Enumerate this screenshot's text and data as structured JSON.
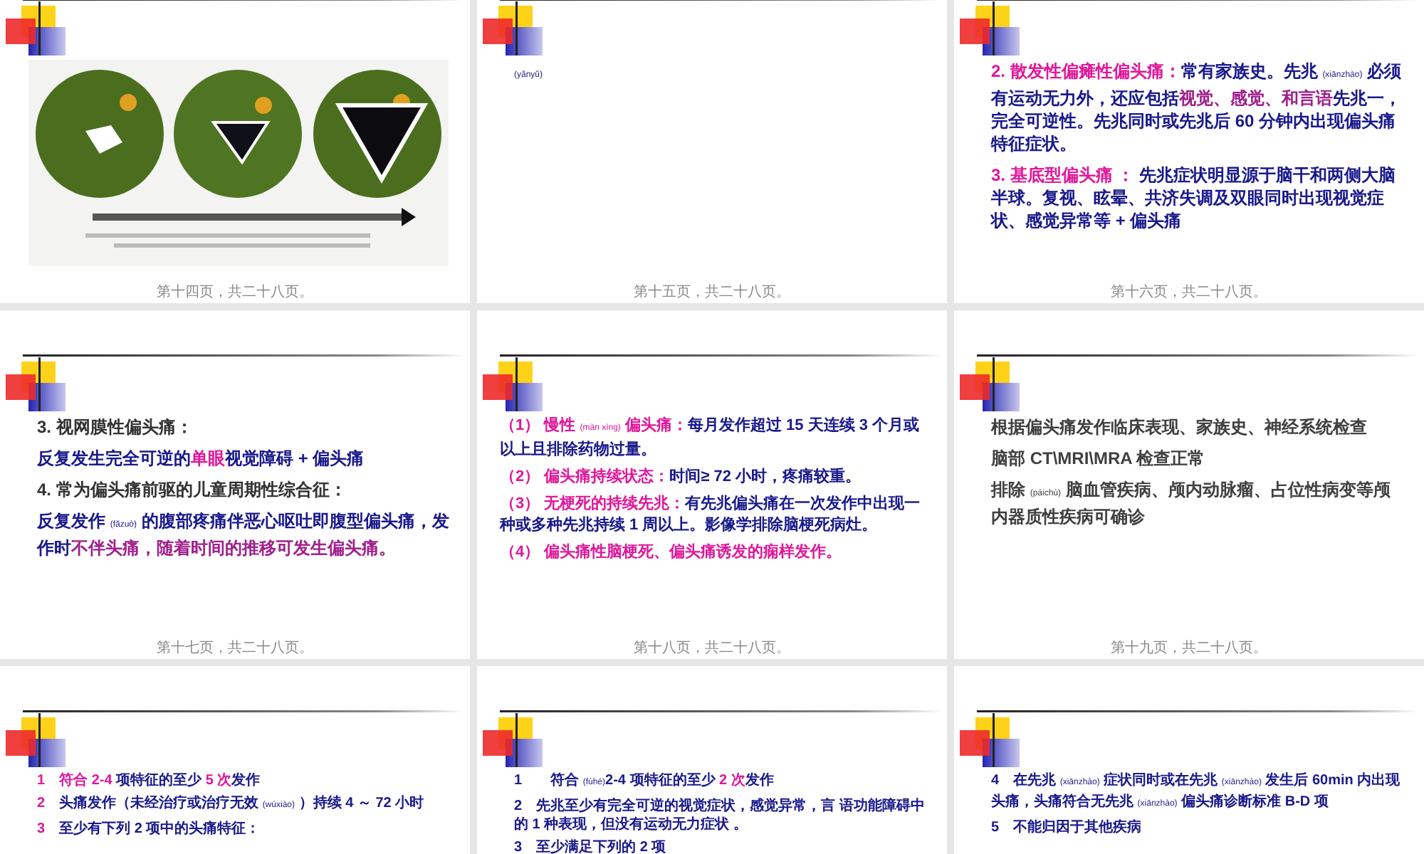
{
  "slides": [
    {
      "kind": "figure",
      "footer": "第十四页，共二十八页。"
    },
    {
      "kind": "text",
      "footer": "第十五页，共二十八页。",
      "paragraphs": [
        {
          "runs": [
            {
              "kind": "note",
              "text": "(yǎnyǔ)",
              "color": "#1a1a8c"
            }
          ]
        }
      ]
    },
    {
      "kind": "text",
      "footer": "第十六页，共二十八页。",
      "paragraphs": [
        {
          "runs": [
            {
              "kind": "text",
              "text": "2. 散发性偏瘫性偏头痛：",
              "color": "#e0189a"
            },
            {
              "kind": "text",
              "text": "常有家族史。先兆 ",
              "color": "#1a1a8c"
            },
            {
              "kind": "note",
              "text": "(xiānzhào)",
              "color": "#1a1a8c"
            },
            {
              "kind": "text",
              "text": " 必须有运动无力外，还应包括",
              "color": "#1a1a8c"
            },
            {
              "kind": "text",
              "text": "视觉、感觉、和言语",
              "color": "#a0208c"
            },
            {
              "kind": "text",
              "text": "先兆一，完全可逆性。先兆同时或先兆后 60 分钟内出现偏头痛特征症状。",
              "color": "#1a1a8c"
            }
          ]
        },
        {
          "runs": [
            {
              "kind": "text",
              "text": "3. 基底型偏头痛 ： ",
              "color": "#e0189a"
            },
            {
              "kind": "text",
              "text": "先兆症状明显源于脑干和两侧大脑半球。复视、眩晕、共济失调及双眼同时出现视觉症状、感觉异常等 + 偏头痛",
              "color": "#1a1a8c"
            }
          ]
        }
      ]
    },
    {
      "kind": "text",
      "footer": "第十七页，共二十八页。",
      "paragraphs": [
        {
          "runs": [
            {
              "kind": "text",
              "text": "3. 视网膜性偏头痛：",
              "color": "#333333"
            }
          ]
        },
        {
          "runs": [
            {
              "kind": "text",
              "text": "反复发生完全可逆的",
              "color": "#1a1a8c"
            },
            {
              "kind": "text",
              "text": "单眼",
              "color": "#e0189a"
            },
            {
              "kind": "text",
              "text": "视觉障碍 + 偏头痛",
              "color": "#1a1a8c"
            }
          ]
        },
        {
          "runs": [
            {
              "kind": "text",
              "text": "4. 常为偏头痛前驱的儿童周期性综合征：",
              "color": "#333333"
            }
          ]
        },
        {
          "runs": [
            {
              "kind": "text",
              "text": "反复发作 ",
              "color": "#1a1a8c"
            },
            {
              "kind": "note",
              "text": "(fǎzuò)",
              "color": "#1a1a8c"
            },
            {
              "kind": "text",
              "text": " 的腹部疼痛伴恶心呕吐即腹型偏头痛，发作时",
              "color": "#1a1a8c"
            },
            {
              "kind": "text",
              "text": "不伴头痛，随着时间的推移可发生偏头痛。",
              "color": "#a0208c"
            }
          ]
        }
      ]
    },
    {
      "kind": "text",
      "footer": "第十八页，共二十八页。",
      "paragraphs": [
        {
          "runs": [
            {
              "kind": "text",
              "text": "（1） 慢性 ",
              "color": "#e0189a"
            },
            {
              "kind": "note",
              "text": "(màn xìng)",
              "color": "#e0189a"
            },
            {
              "kind": "text",
              "text": " 偏头痛：",
              "color": "#e0189a"
            },
            {
              "kind": "text",
              "text": "每月发作超过 15 天连续 3 个月或以上且排除药物过量。",
              "color": "#1a1a8c"
            }
          ]
        },
        {
          "runs": [
            {
              "kind": "text",
              "text": "（2） 偏头痛持续状态：",
              "color": "#e0189a"
            },
            {
              "kind": "text",
              "text": "时间≥ 72 小时，疼痛较重。",
              "color": "#1a1a8c"
            }
          ]
        },
        {
          "runs": [
            {
              "kind": "text",
              "text": "（3） 无梗死的持续先兆：",
              "color": "#e0189a"
            },
            {
              "kind": "text",
              "text": "有先兆偏头痛在一次发作中出现一种或多种先兆持续 1 周以上。影像学排除脑梗死病灶。",
              "color": "#1a1a8c"
            }
          ]
        },
        {
          "runs": [
            {
              "kind": "text",
              "text": "（4） 偏头痛性脑梗死、偏头痛诱发的痫样发作。",
              "color": "#e0189a"
            }
          ]
        }
      ]
    },
    {
      "kind": "text",
      "footer": "第十九页，共二十八页。",
      "paragraphs": [
        {
          "runs": [
            {
              "kind": "text",
              "text": "根据偏头痛发作临床表现、家族史、神经系统检查",
              "color": "#404040"
            }
          ]
        },
        {
          "runs": [
            {
              "kind": "text",
              "text": "脑部 CT\\MRI\\MRA 检查正常",
              "color": "#404040"
            }
          ]
        },
        {
          "runs": [
            {
              "kind": "text",
              "text": "排除 ",
              "color": "#404040"
            },
            {
              "kind": "note",
              "text": "(páichú)",
              "color": "#404040"
            },
            {
              "kind": "text",
              "text": " 脑血管疾病、颅内动脉瘤、占位性病变等颅内器质性疾病可确诊",
              "color": "#404040"
            }
          ]
        }
      ]
    },
    {
      "kind": "text",
      "paragraphs": [
        {
          "runs": [
            {
              "kind": "text",
              "text": "1　符合 ",
              "color": "#e0189a"
            },
            {
              "kind": "text",
              "text": "2-4",
              "color": "#e0189a"
            },
            {
              "kind": "text",
              "text": " 项特征的至少 ",
              "color": "#1a1a8c"
            },
            {
              "kind": "text",
              "text": "5 次",
              "color": "#e0189a"
            },
            {
              "kind": "text",
              "text": "发作",
              "color": "#1a1a8c"
            }
          ]
        },
        {
          "runs": [
            {
              "kind": "text",
              "text": "2　",
              "color": "#e0189a"
            },
            {
              "kind": "text",
              "text": "头痛发作（未经治疗或治疗无效 ",
              "color": "#1a1a8c"
            },
            {
              "kind": "note",
              "text": "(wúxiào)",
              "color": "#1a1a8c"
            },
            {
              "kind": "text",
              "text": " ）持续 4 ～ 72 小时",
              "color": "#1a1a8c"
            }
          ]
        },
        {
          "runs": [
            {
              "kind": "text",
              "text": "3　",
              "color": "#e0189a"
            },
            {
              "kind": "text",
              "text": "至少有下列 2 项中的头痛特征：",
              "color": "#1a1a8c"
            }
          ]
        }
      ]
    },
    {
      "kind": "text",
      "paragraphs": [
        {
          "runs": [
            {
              "kind": "text",
              "text": "1　　符合 ",
              "color": "#1a1a8c"
            },
            {
              "kind": "note",
              "text": "(fúhé)",
              "color": "#1a1a8c"
            },
            {
              "kind": "text",
              "text": "2-4 项特征的至少 ",
              "color": "#1a1a8c"
            },
            {
              "kind": "text",
              "text": "2 次",
              "color": "#e0189a"
            },
            {
              "kind": "text",
              "text": "发作",
              "color": "#1a1a8c"
            }
          ]
        },
        {
          "runs": [
            {
              "kind": "text",
              "text": "2　先兆至少有完全可逆的视觉症状，感觉异常，言 语功能障碍中的 1 种表现，但没有运动无力症状 。",
              "color": "#1a1a8c"
            }
          ]
        },
        {
          "runs": [
            {
              "kind": "text",
              "text": "3　至少满足下列的 2 项",
              "color": "#1a1a8c"
            }
          ]
        }
      ]
    },
    {
      "kind": "text",
      "paragraphs": [
        {
          "runs": [
            {
              "kind": "text",
              "text": "4　在先兆 ",
              "color": "#1a1a8c"
            },
            {
              "kind": "note",
              "text": "(xiānzhào)",
              "color": "#1a1a8c"
            },
            {
              "kind": "text",
              "text": " 症状同时或在先兆 ",
              "color": "#1a1a8c"
            },
            {
              "kind": "note",
              "text": "(xiānzhào)",
              "color": "#1a1a8c"
            },
            {
              "kind": "text",
              "text": " 发生后 60min 内出现头痛，头痛符合无先兆 ",
              "color": "#1a1a8c"
            },
            {
              "kind": "note",
              "text": "(xiānzhào)",
              "color": "#1a1a8c"
            },
            {
              "kind": "text",
              "text": " 偏头痛诊断标准 B-D 项",
              "color": "#1a1a8c"
            }
          ]
        },
        {
          "runs": [
            {
              "kind": "text",
              "text": "5　不能归因于其他疾病",
              "color": "#1a1a8c"
            }
          ]
        }
      ]
    }
  ]
}
